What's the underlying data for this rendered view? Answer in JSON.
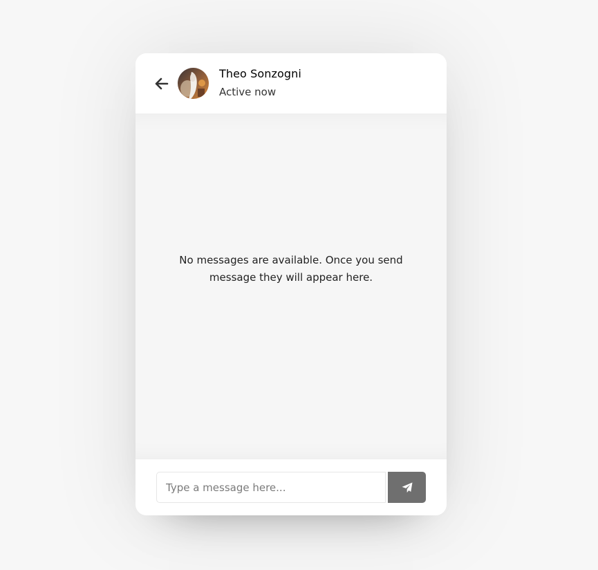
{
  "header": {
    "user_name": "Theo Sonzogni",
    "status": "Active now",
    "back_icon": "arrow-left-icon",
    "avatar": "user-avatar-photo"
  },
  "chat": {
    "empty_line1": "No messages are available. Once you send",
    "empty_line2": "message they will appear here."
  },
  "composer": {
    "input_value": "",
    "placeholder": "Type a message here...",
    "send_icon": "paper-plane-icon"
  },
  "colors": {
    "page_background": "#f7f7f7",
    "chat_background": "#f6f6f6",
    "send_button": "#6f6f6f"
  }
}
